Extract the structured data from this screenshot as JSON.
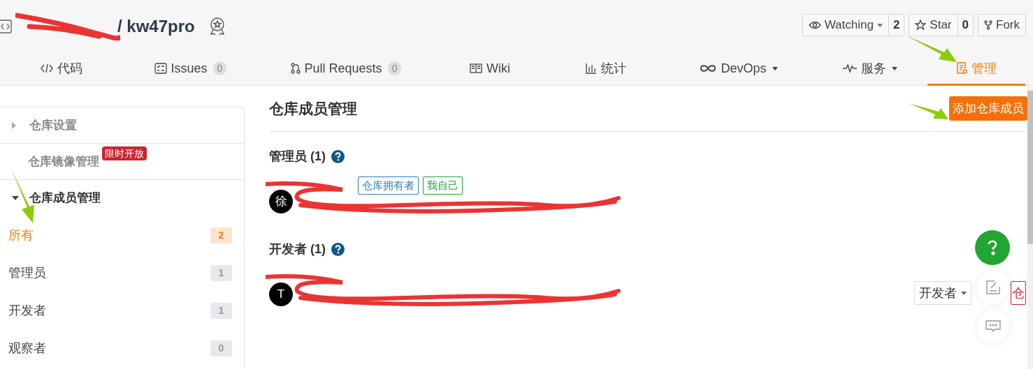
{
  "repo": {
    "path": "/ kw47pro"
  },
  "repo_actions": [
    {
      "label": "Watching",
      "count": "2",
      "dropdown": true
    },
    {
      "label": "Star",
      "count": "0",
      "dropdown": false
    },
    {
      "label": "Fork",
      "dropdown": false
    }
  ],
  "tabs": [
    {
      "label": "代码",
      "selected": false,
      "dropdown": false
    },
    {
      "label": "Issues",
      "count": "0",
      "selected": false,
      "dropdown": false
    },
    {
      "label": "Pull Requests",
      "count": "0",
      "selected": false,
      "dropdown": false
    },
    {
      "label": "Wiki",
      "selected": false,
      "dropdown": false
    },
    {
      "label": "统计",
      "selected": false,
      "dropdown": false
    },
    {
      "label": "DevOps",
      "selected": false,
      "dropdown": true
    },
    {
      "label": "服务",
      "selected": false,
      "dropdown": true
    },
    {
      "label": "管理",
      "selected": true,
      "dropdown": false
    }
  ],
  "sidebar": {
    "sections": [
      {
        "label": "仓库设置",
        "expanded": false,
        "has_arrow": true
      },
      {
        "label": "仓库镜像管理",
        "expanded": false,
        "has_arrow": false,
        "badge": "限时开放"
      },
      {
        "label": "仓库成员管理",
        "expanded": true,
        "has_arrow": true
      }
    ],
    "filters": [
      {
        "label": "所有",
        "count": "2",
        "selected": true
      },
      {
        "label": "管理员",
        "count": "1",
        "selected": false
      },
      {
        "label": "开发者",
        "count": "1",
        "selected": false
      },
      {
        "label": "观察者",
        "count": "0",
        "selected": false
      }
    ]
  },
  "main": {
    "title": "仓库成员管理",
    "add_button": "添加仓库成员",
    "groups": [
      {
        "title": "管理员 (1)",
        "members": [
          {
            "avatar": "徐",
            "tags": [
              {
                "label": "仓库拥有者",
                "color": "#2e7dc0"
              },
              {
                "label": "我自己",
                "color": "#21a336"
              }
            ]
          }
        ]
      },
      {
        "title": "开发者 (1)",
        "members": [
          {
            "avatar": "T",
            "role": "开发者",
            "remove_button": "仓"
          }
        ]
      }
    ]
  }
}
